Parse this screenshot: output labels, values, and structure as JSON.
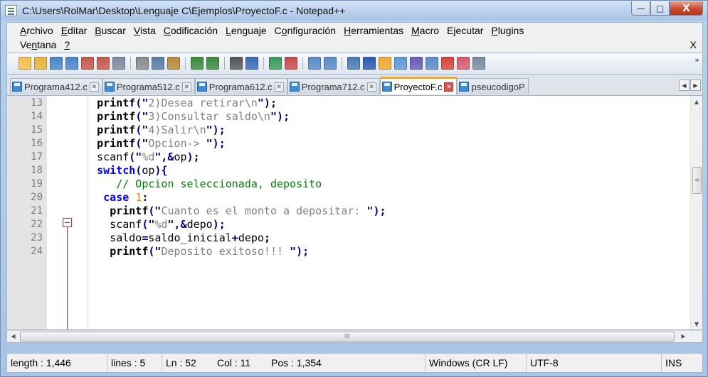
{
  "window": {
    "title": "C:\\Users\\RolMar\\Desktop\\Lenguaje C\\Ejemplos\\ProyectoF.c - Notepad++",
    "minimize": "—",
    "maximize": "□",
    "close": "X"
  },
  "menu": {
    "row1": [
      {
        "hot": "A",
        "rest": "rchivo"
      },
      {
        "hot": "E",
        "rest": "ditar"
      },
      {
        "hot": "B",
        "rest": "uscar"
      },
      {
        "hot": "V",
        "rest": "ista"
      },
      {
        "hot": "C",
        "rest": "odificación"
      },
      {
        "hot": "L",
        "rest": "enguaje"
      },
      {
        "pre": "C",
        "hot": "o",
        "rest": "nfiguración"
      },
      {
        "hot": "H",
        "rest": "erramientas"
      },
      {
        "hot": "M",
        "rest": "acro"
      },
      {
        "pre": "E",
        "hot": "j",
        "rest": "ecutar"
      },
      {
        "hot": "P",
        "rest": "lugins"
      }
    ],
    "row2": [
      {
        "pre": "Ve",
        "hot": "n",
        "rest": "tana"
      },
      {
        "hot": "?",
        "rest": ""
      }
    ],
    "close": "X"
  },
  "toolbar": {
    "more": "»",
    "icons": [
      {
        "name": "new-file-icon",
        "color": "#f3c14b"
      },
      {
        "name": "open-file-icon",
        "color": "#e8b33a"
      },
      {
        "name": "save-icon",
        "color": "#4a84c8"
      },
      {
        "name": "save-all-icon",
        "color": "#4a84c8"
      },
      {
        "name": "close-icon",
        "color": "#c8574a"
      },
      {
        "name": "close-all-icon",
        "color": "#c8574a"
      },
      {
        "name": "print-icon",
        "color": "#7a8aa0"
      },
      {
        "sep": true
      },
      {
        "name": "cut-icon",
        "color": "#8a8a8a"
      },
      {
        "name": "copy-icon",
        "color": "#5a7aa8"
      },
      {
        "name": "paste-icon",
        "color": "#b88a3a"
      },
      {
        "sep": true
      },
      {
        "name": "undo-icon",
        "color": "#3a8a3a"
      },
      {
        "name": "redo-icon",
        "color": "#3a8a3a"
      },
      {
        "sep": true
      },
      {
        "name": "find-icon",
        "color": "#555555"
      },
      {
        "name": "replace-icon",
        "color": "#3a6ab8"
      },
      {
        "sep": true
      },
      {
        "name": "zoom-in-icon",
        "color": "#3a9a5a"
      },
      {
        "name": "zoom-out-icon",
        "color": "#c84a4a"
      },
      {
        "sep": true
      },
      {
        "name": "sync-v-icon",
        "color": "#5a8ac8"
      },
      {
        "name": "sync-h-icon",
        "color": "#5a8ac8"
      },
      {
        "sep": true
      },
      {
        "name": "word-wrap-icon",
        "color": "#4a7ab8"
      },
      {
        "name": "show-all-chars-icon",
        "color": "#2a5ab0"
      },
      {
        "name": "indent-guide-icon",
        "color": "#f0a830"
      },
      {
        "name": "udl-icon",
        "color": "#5a9ad8"
      },
      {
        "name": "doc-map-icon",
        "color": "#6a5ab8"
      },
      {
        "name": "function-list-icon",
        "color": "#5a8ac8"
      },
      {
        "name": "folder-workspace-icon",
        "color": "#d8443a"
      },
      {
        "name": "monitor-icon",
        "color": "#d85a6a"
      },
      {
        "name": "eye-icon",
        "color": "#7a8aa0"
      }
    ]
  },
  "tabs": [
    {
      "label": "Programa412.c",
      "close": "✕",
      "active": false
    },
    {
      "label": "Programa512.c",
      "close": "✕",
      "active": false
    },
    {
      "label": "Programa612.c",
      "close": "✕",
      "active": false
    },
    {
      "label": "Programa712.c",
      "close": "✕",
      "active": false
    },
    {
      "label": "ProyectoF.c",
      "close": "✕",
      "active": true
    },
    {
      "label": "pseucodigoP",
      "close": "",
      "active": false
    }
  ],
  "tab_nav": {
    "left": "◀",
    "right": "▶"
  },
  "editor": {
    "lines": [
      {
        "n": "13",
        "ind": "    ",
        "tokens": [
          [
            "kw",
            "printf"
          ],
          [
            "op",
            "(\""
          ],
          [
            "str",
            "2)Desea retirar\\n"
          ],
          [
            "op",
            "\");"
          ]
        ]
      },
      {
        "n": "14",
        "ind": "    ",
        "tokens": [
          [
            "kw",
            "printf"
          ],
          [
            "op",
            "(\""
          ],
          [
            "str",
            "3)Consultar saldo\\n"
          ],
          [
            "op",
            "\");"
          ]
        ]
      },
      {
        "n": "15",
        "ind": "    ",
        "tokens": [
          [
            "kw",
            "printf"
          ],
          [
            "op",
            "(\""
          ],
          [
            "str",
            "4)Salir\\n"
          ],
          [
            "op",
            "\");"
          ]
        ]
      },
      {
        "n": "16",
        "ind": "    ",
        "tokens": [
          [
            "kw",
            "printf"
          ],
          [
            "op",
            "(\""
          ],
          [
            "str",
            "Opcion-> "
          ],
          [
            "op",
            "\");"
          ]
        ]
      },
      {
        "n": "17",
        "ind": "    ",
        "tokens": [
          [
            "plain",
            "scanf"
          ],
          [
            "op",
            "(\""
          ],
          [
            "str",
            "%d"
          ],
          [
            "op",
            "\",&"
          ],
          [
            "plain",
            "op"
          ],
          [
            "op",
            ");"
          ]
        ]
      },
      {
        "n": "18",
        "ind": "    ",
        "tokens": [
          [
            "kwb",
            "switch"
          ],
          [
            "op",
            "("
          ],
          [
            "plain",
            "op"
          ],
          [
            "op",
            "){"
          ]
        ]
      },
      {
        "n": "19",
        "ind": "       ",
        "tokens": [
          [
            "cmt",
            "// Opcion seleccionada, deposito"
          ]
        ]
      },
      {
        "n": "20",
        "ind": "     ",
        "tokens": [
          [
            "kwb",
            "case"
          ],
          [
            "plain",
            " "
          ],
          [
            "num",
            "1"
          ],
          [
            "op",
            ":"
          ]
        ]
      },
      {
        "n": "21",
        "ind": "      ",
        "tokens": [
          [
            "kw",
            "printf"
          ],
          [
            "op",
            "(\""
          ],
          [
            "str",
            "Cuanto es el monto a depositar: "
          ],
          [
            "op",
            "\");"
          ]
        ]
      },
      {
        "n": "22",
        "ind": "      ",
        "tokens": [
          [
            "plain",
            "scanf"
          ],
          [
            "op",
            "(\""
          ],
          [
            "str",
            "%d"
          ],
          [
            "op",
            "\",&"
          ],
          [
            "plain",
            "depo"
          ],
          [
            "op",
            ");"
          ]
        ]
      },
      {
        "n": "23",
        "ind": "      ",
        "tokens": [
          [
            "plain",
            "saldo"
          ],
          [
            "op",
            "="
          ],
          [
            "plain",
            "saldo_inicial"
          ],
          [
            "op",
            "+"
          ],
          [
            "plain",
            "depo"
          ],
          [
            "op",
            ";"
          ]
        ]
      },
      {
        "n": "24",
        "ind": "      ",
        "tokens": [
          [
            "kw",
            "printf"
          ],
          [
            "op",
            "(\""
          ],
          [
            "str",
            "Deposito exitoso!!! "
          ],
          [
            "op",
            "\");"
          ]
        ]
      }
    ]
  },
  "scroll": {
    "up": "▲",
    "down": "▼",
    "left": "◀",
    "right": "▶",
    "grip_v": "≡",
    "grip_h": "III"
  },
  "status": {
    "length": "length : 1,446",
    "lines": "lines : 5",
    "ln": "Ln : 52",
    "col": "Col : 11",
    "pos": "Pos : 1,354",
    "eol": "Windows (CR LF)",
    "encoding": "UTF-8",
    "mode": "INS"
  }
}
